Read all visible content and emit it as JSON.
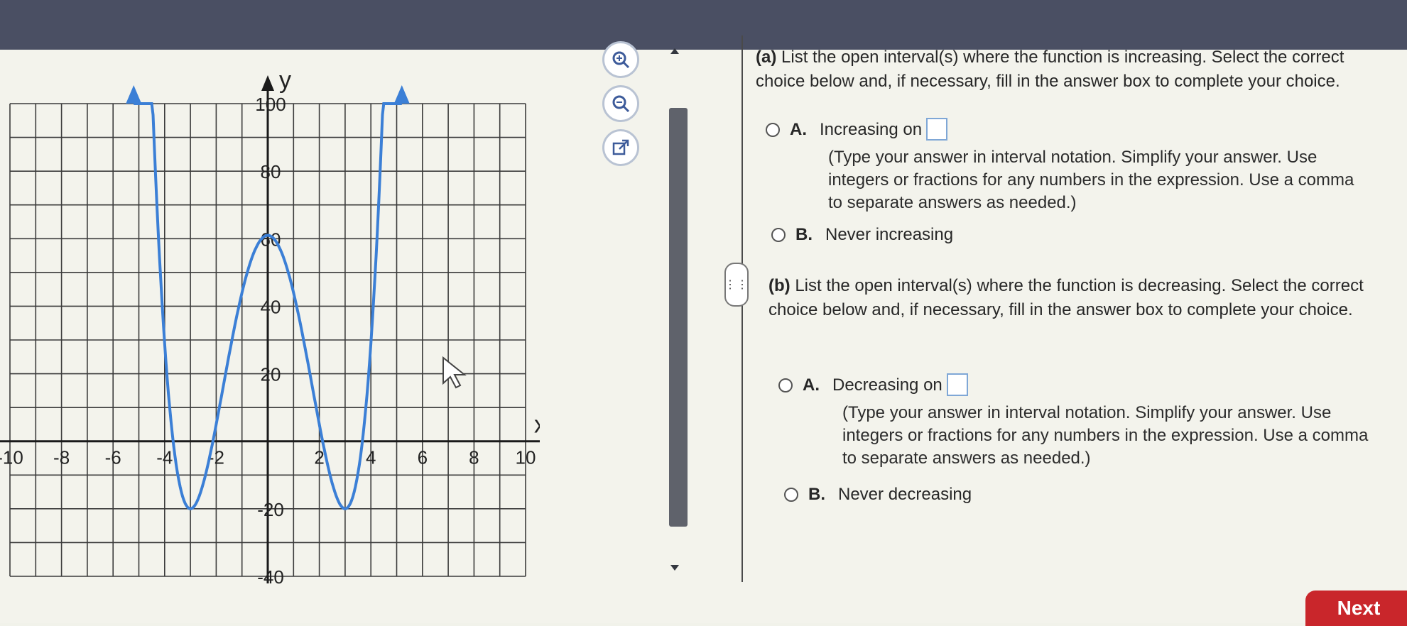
{
  "graph": {
    "axis_x_label": "x",
    "axis_y_label": "y",
    "x_tick_labels": [
      "-10",
      "-8",
      "-6",
      "-4",
      "-2",
      "2",
      "4",
      "6",
      "8",
      "10"
    ],
    "y_tick_labels": [
      "100",
      "80",
      "60",
      "40",
      "20",
      "-20",
      "-40"
    ],
    "curve_color": "#3b7fd6"
  },
  "tools": {
    "zoom_in_icon": "zoom-in-icon",
    "zoom_out_icon": "zoom-out-icon",
    "popout_icon": "external-link-icon"
  },
  "part_a": {
    "prompt_lead": "(a)",
    "prompt_text": "List the open interval(s) where the function is increasing. Select the correct choice below and, if necessary, fill in the answer box to complete your choice.",
    "option_a_letter": "A.",
    "option_a_label": "Increasing on",
    "option_a_hint": "(Type your answer in interval notation. Simplify your answer. Use integers or fractions for any numbers in the expression. Use a comma to separate answers as needed.)",
    "option_b_letter": "B.",
    "option_b_label": "Never increasing"
  },
  "part_b": {
    "prompt_lead": "(b)",
    "prompt_text": "List the open interval(s) where the function is decreasing. Select the correct choice below and, if necessary, fill in the answer box to complete your choice.",
    "option_a_letter": "A.",
    "option_a_label": "Decreasing on",
    "option_a_hint": "(Type your answer in interval notation. Simplify your answer. Use integers or fractions for any numbers in the expression. Use a comma to separate answers as needed.)",
    "option_b_letter": "B.",
    "option_b_label": "Never decreasing"
  },
  "handle_label": "⋮⋮",
  "next_label": "Next"
}
